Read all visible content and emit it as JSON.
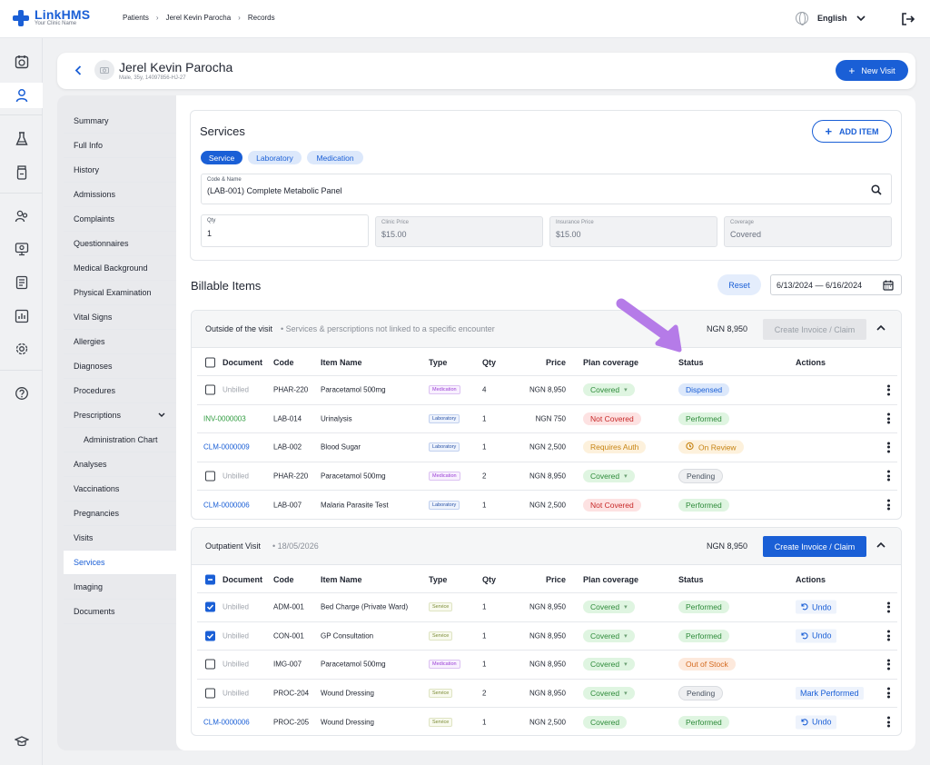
{
  "app": {
    "brand": "LinkHMS",
    "tagline": "Your Clinic Name",
    "breadcrumb": [
      "Patients",
      "Jerel Kevin Parocha",
      "Records"
    ],
    "language": "English"
  },
  "patient": {
    "name": "Jerel Kevin Parocha",
    "meta": "Male, 35y, 14097856-HJ-27",
    "new_visit_label": "New Visit"
  },
  "sidenav": {
    "items": [
      "Summary",
      "Full Info",
      "History",
      "Admissions",
      "Complaints",
      "Questionnaires",
      "Medical Background",
      "Physical Examination",
      "Vital Signs",
      "Allergies",
      "Diagnoses",
      "Procedures",
      "Prescriptions",
      "Administration Chart",
      "Analyses",
      "Vaccinations",
      "Pregnancies",
      "Visits",
      "Services",
      "Imaging",
      "Documents"
    ],
    "active": "Services"
  },
  "services": {
    "title": "Services",
    "add_item_label": "ADD ITEM",
    "tabs": [
      "Service",
      "Laboratory",
      "Medication"
    ],
    "code_name": {
      "label": "Code & Name",
      "value": "(LAB-001) Complete Metabolic Panel"
    },
    "qty": {
      "label": "Qty",
      "value": "1"
    },
    "clinic_price": {
      "label": "Clinic Price",
      "value": "$15.00"
    },
    "insurance_price": {
      "label": "Insurance Price",
      "value": "$15.00"
    },
    "coverage": {
      "label": "Coverage",
      "value": "Covered"
    }
  },
  "billable": {
    "title": "Billable Items",
    "reset_label": "Reset",
    "date_range": "6/13/2024 — 6/16/2024",
    "columns": [
      "Document",
      "Code",
      "Item Name",
      "Type",
      "Qty",
      "Price",
      "Plan coverage",
      "Status",
      "Actions"
    ],
    "groups": [
      {
        "title": "Outside of the visit",
        "subtitle": "Services & perscriptions not linked to a specific encounter",
        "total": "NGN 8,950",
        "invoice_label": "Create Invoice / Claim",
        "rows": [
          {
            "doc": "Unbilled",
            "code": "PHAR-220",
            "name": "Paracetamol 500mg",
            "type": "Medication",
            "qty": "4",
            "price": "NGN 8,950",
            "coverage": "Covered",
            "status": "Dispensed",
            "action": ""
          },
          {
            "doc": "INV-0000003",
            "code": "LAB-014",
            "name": "Urinalysis",
            "type": "Laboratory",
            "qty": "1",
            "price": "NGN 750",
            "coverage": "Not Covered",
            "status": "Performed",
            "action": ""
          },
          {
            "doc": "CLM-0000009",
            "code": "LAB-002",
            "name": "Blood Sugar",
            "type": "Laboratory",
            "qty": "1",
            "price": "NGN 2,500",
            "coverage": "Requires Auth",
            "status": "On Review",
            "action": ""
          },
          {
            "doc": "Unbilled",
            "code": "PHAR-220",
            "name": "Paracetamol 500mg",
            "type": "Medication",
            "qty": "2",
            "price": "NGN 8,950",
            "coverage": "Covered",
            "status": "Pending",
            "action": ""
          },
          {
            "doc": "CLM-0000006",
            "code": "LAB-007",
            "name": "Malaria Parasite Test",
            "type": "Laboratory",
            "qty": "1",
            "price": "NGN 2,500",
            "coverage": "Not Covered",
            "status": "Performed",
            "action": ""
          }
        ]
      },
      {
        "title": "Outpatient Visit",
        "subtitle": "18/05/2026",
        "total": "NGN 8,950",
        "invoice_label": "Create Invoice / Claim",
        "rows": [
          {
            "doc": "Unbilled",
            "code": "ADM-001",
            "name": "Bed Charge (Private Ward)",
            "type": "Service",
            "qty": "1",
            "price": "NGN 8,950",
            "coverage": "Covered",
            "status": "Performed",
            "action": "Undo"
          },
          {
            "doc": "Unbilled",
            "code": "CON-001",
            "name": "GP Consultation",
            "type": "Service",
            "qty": "1",
            "price": "NGN 8,950",
            "coverage": "Covered",
            "status": "Performed",
            "action": "Undo"
          },
          {
            "doc": "Unbilled",
            "code": "IMG-007",
            "name": "Paracetamol 500mg",
            "type": "Medication",
            "qty": "1",
            "price": "NGN 8,950",
            "coverage": "Covered",
            "status": "Out of Stock",
            "action": ""
          },
          {
            "doc": "Unbilled",
            "code": "PROC-204",
            "name": "Wound Dressing",
            "type": "Service",
            "qty": "2",
            "price": "NGN 8,950",
            "coverage": "Covered",
            "status": "Pending",
            "action": "Mark Performed"
          },
          {
            "doc": "CLM-0000006",
            "code": "PROC-205",
            "name": "Wound Dressing",
            "type": "Service",
            "qty": "1",
            "price": "NGN 2,500",
            "coverage": "Covered",
            "status": "Performed",
            "action": "Undo"
          }
        ]
      }
    ]
  },
  "colors": {
    "accent": "#1a5fd6",
    "covered": "#2e8b3a",
    "not_covered": "#c72828",
    "warning": "#c78413",
    "arrow": "#b57be8"
  }
}
